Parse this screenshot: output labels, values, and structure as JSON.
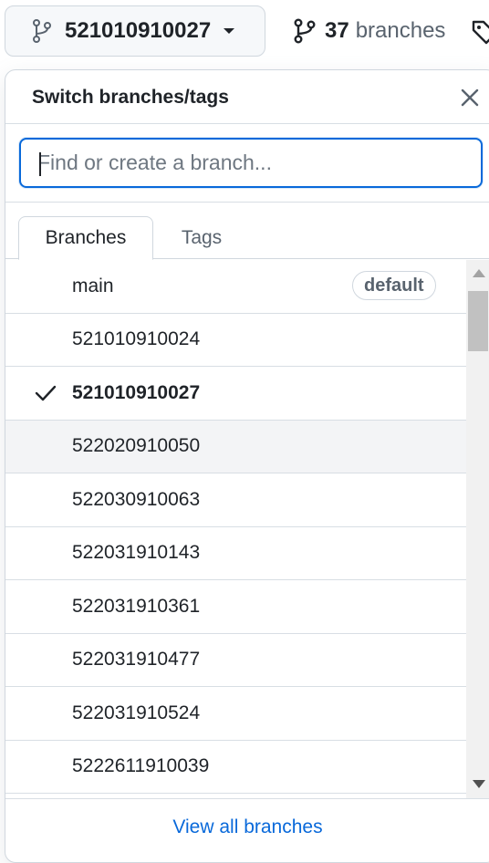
{
  "toolbar": {
    "current_branch": "521010910027",
    "branch_count": "37",
    "branch_word": "branches"
  },
  "dropdown": {
    "title": "Switch branches/tags",
    "filter_placeholder": "Find or create a branch...",
    "filter_value": "",
    "tabs": [
      {
        "label": "Branches",
        "active": true
      },
      {
        "label": "Tags",
        "active": false
      }
    ],
    "default_badge": "default",
    "branches": [
      {
        "name": "main",
        "default": true,
        "selected": false
      },
      {
        "name": "521010910024",
        "default": false,
        "selected": false
      },
      {
        "name": "521010910027",
        "default": false,
        "selected": true
      },
      {
        "name": "522020910050",
        "default": false,
        "selected": false
      },
      {
        "name": "522030910063",
        "default": false,
        "selected": false
      },
      {
        "name": "522031910143",
        "default": false,
        "selected": false
      },
      {
        "name": "522031910361",
        "default": false,
        "selected": false
      },
      {
        "name": "522031910477",
        "default": false,
        "selected": false
      },
      {
        "name": "522031910524",
        "default": false,
        "selected": false
      },
      {
        "name": "5222611910039",
        "default": false,
        "selected": false
      }
    ],
    "footer_link": "View all branches"
  },
  "colors": {
    "accent": "#0969da",
    "muted_text": "#59636e",
    "border": "#d0d7de",
    "hover_row": "#f3f4f6"
  }
}
